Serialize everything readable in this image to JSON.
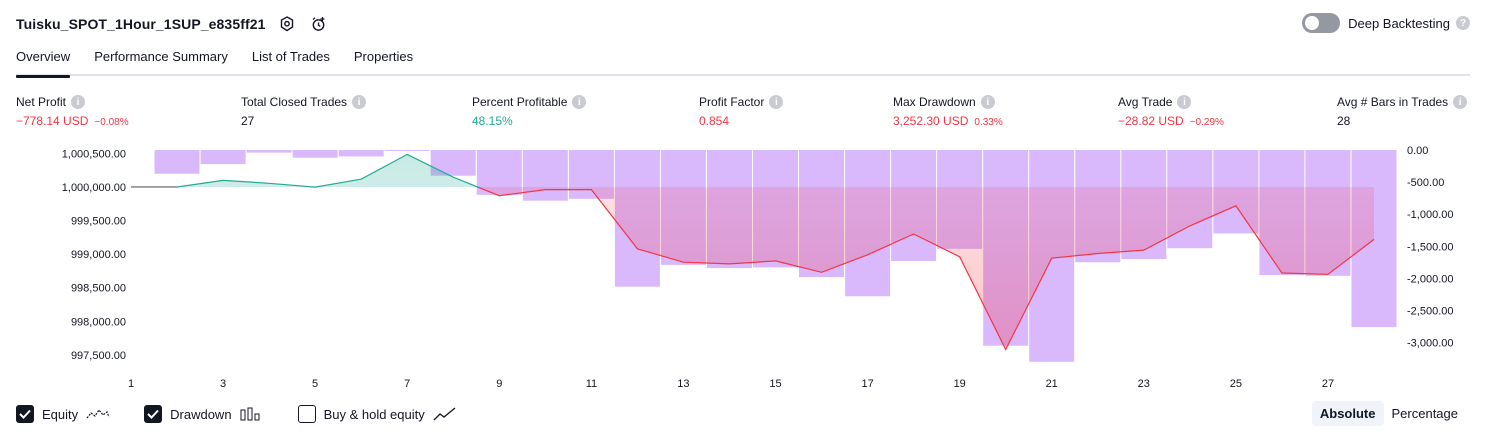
{
  "header": {
    "title": "Tuisku_SPOT_1Hour_1SUP_e835ff21",
    "deep_backtesting_label": "Deep Backtesting",
    "deep_backtesting_on": false
  },
  "tabs": [
    {
      "label": "Overview",
      "active": true
    },
    {
      "label": "Performance Summary",
      "active": false
    },
    {
      "label": "List of Trades",
      "active": false
    },
    {
      "label": "Properties",
      "active": false
    }
  ],
  "metrics": [
    {
      "label": "Net Profit",
      "value": "−778.14 USD",
      "pct": "−0.08%",
      "tone": "neg"
    },
    {
      "label": "Total Closed Trades",
      "value": "27",
      "pct": "",
      "tone": "plain"
    },
    {
      "label": "Percent Profitable",
      "value": "48.15%",
      "pct": "",
      "tone": "pos"
    },
    {
      "label": "Profit Factor",
      "value": "0.854",
      "pct": "",
      "tone": "neg"
    },
    {
      "label": "Max Drawdown",
      "value": "3,252.30 USD",
      "pct": "0.33%",
      "tone": "neg"
    },
    {
      "label": "Avg Trade",
      "value": "−28.82 USD",
      "pct": "−0.29%",
      "tone": "neg"
    },
    {
      "label": "Avg # Bars in Trades",
      "value": "28",
      "pct": "",
      "tone": "plain"
    }
  ],
  "chart_data": {
    "type": "line",
    "title": "",
    "colors": {
      "equity_up": "#22ab94",
      "equity_down": "#f23645",
      "drawdown_bar": "#d9b8fb",
      "buy_hold": "#787b86"
    },
    "x_ticks": [
      "1",
      "3",
      "5",
      "7",
      "9",
      "11",
      "13",
      "15",
      "17",
      "19",
      "21",
      "23",
      "25",
      "27"
    ],
    "left_axis": {
      "ticks": [
        "1,000,500.00",
        "1,000,000.00",
        "999,500.00",
        "999,000.00",
        "998,500.00",
        "998,000.00",
        "997,500.00"
      ],
      "ylim": [
        997350,
        1000550
      ]
    },
    "right_axis": {
      "ticks": [
        "0.00",
        "-500.00",
        "-1,000.00",
        "-1,500.00",
        "-2,000.00",
        "-2,500.00",
        "-3,000.00"
      ],
      "ylim": [
        -3350,
        0
      ]
    },
    "x": [
      0,
      1,
      2,
      3,
      4,
      5,
      6,
      7,
      8,
      9,
      10,
      11,
      12,
      13,
      14,
      15,
      16,
      17,
      18,
      19,
      20,
      21,
      22,
      23,
      24,
      25,
      26,
      27,
      28
    ],
    "equity": [
      1000000,
      1000000,
      1000098,
      1000055,
      999998,
      1000115,
      1000485,
      1000145,
      999870,
      999960,
      999960,
      999080,
      998880,
      998855,
      998900,
      998730,
      998990,
      999300,
      998960,
      997580,
      998940,
      999010,
      999060,
      999420,
      999720,
      998720,
      998700,
      999220
    ],
    "drawdown_bars": [
      0,
      -370,
      -220,
      -40,
      -120,
      -100,
      0,
      -400,
      -700,
      -790,
      -760,
      -2130,
      -1790,
      -1840,
      -1830,
      -1980,
      -2280,
      -1730,
      -1540,
      -3050,
      -3300,
      -1750,
      -1700,
      -1530,
      -1300,
      -1950,
      -1960,
      -2760
    ],
    "series": [
      {
        "name": "Equity",
        "visible": true
      },
      {
        "name": "Drawdown",
        "visible": true
      },
      {
        "name": "Buy & hold equity",
        "visible": false
      }
    ]
  },
  "legend": {
    "equity_label": "Equity",
    "drawdown_label": "Drawdown",
    "buyhold_label": "Buy & hold equity",
    "equity_checked": true,
    "drawdown_checked": true,
    "buyhold_checked": false
  },
  "mode": {
    "absolute_label": "Absolute",
    "percentage_label": "Percentage",
    "active": "Absolute"
  }
}
